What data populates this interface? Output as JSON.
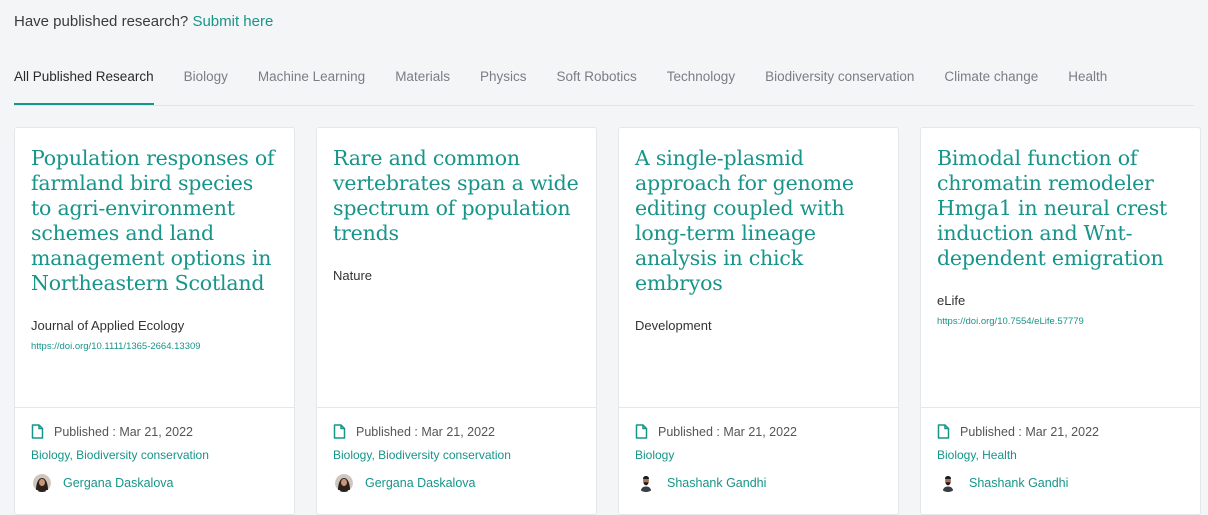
{
  "header": {
    "prompt": "Have published research?",
    "submit_link": "Submit here"
  },
  "tabs": [
    {
      "label": "All Published Research",
      "active": true
    },
    {
      "label": "Biology"
    },
    {
      "label": "Machine Learning"
    },
    {
      "label": "Materials"
    },
    {
      "label": "Physics"
    },
    {
      "label": "Soft Robotics"
    },
    {
      "label": "Technology"
    },
    {
      "label": "Biodiversity conservation"
    },
    {
      "label": "Climate change"
    },
    {
      "label": "Health"
    }
  ],
  "colors": {
    "accent": "#17958a",
    "background": "#f4f5f7",
    "card": "#ffffff"
  },
  "cards": [
    {
      "title": "Population responses of farmland bird species to agri-environment schemes and land management options in Northeastern Scotland",
      "journal": "Journal of Applied Ecology",
      "doi": "https://doi.org/10.1111/1365-2664.13309",
      "published": "Published : Mar 21, 2022",
      "categories": "Biology, Biodiversity conservation",
      "author": "Gergana Daskalova",
      "avatar": "female-avatar"
    },
    {
      "title": "Rare and common vertebrates span a wide spectrum of population trends",
      "journal": "Nature",
      "doi": "",
      "published": "Published : Mar 21, 2022",
      "categories": "Biology, Biodiversity conservation",
      "author": "Gergana Daskalova",
      "avatar": "female-avatar"
    },
    {
      "title": "A single-plasmid approach for genome editing coupled with long-term lineage analysis in chick embryos",
      "journal": "Development",
      "doi": "",
      "published": "Published : Mar 21, 2022",
      "categories": "Biology",
      "author": "Shashank Gandhi",
      "avatar": "male-avatar"
    },
    {
      "title": "Bimodal function of chromatin remodeler Hmga1 in neural crest induction and Wnt-dependent emigration",
      "journal": "eLife",
      "doi": "https://doi.org/10.7554/eLife.57779",
      "published": "Published : Mar 21, 2022",
      "categories": "Biology, Health",
      "author": "Shashank Gandhi",
      "avatar": "male-avatar"
    }
  ]
}
